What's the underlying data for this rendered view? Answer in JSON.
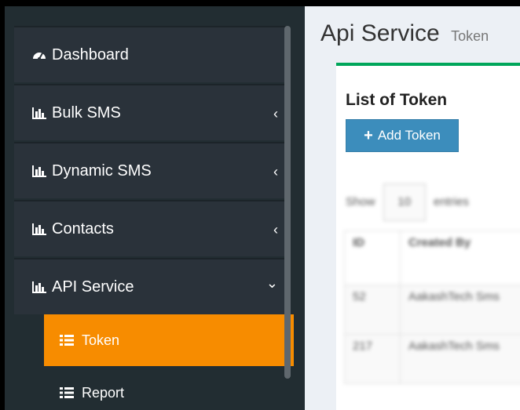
{
  "sidebar": {
    "items": [
      {
        "label": "Dashboard",
        "icon": "dashboard-icon",
        "chevron": ""
      },
      {
        "label": "Bulk SMS",
        "icon": "bar-chart-icon",
        "chevron": "‹"
      },
      {
        "label": "Dynamic SMS",
        "icon": "bar-chart-icon",
        "chevron": "‹"
      },
      {
        "label": "Contacts",
        "icon": "bar-chart-icon",
        "chevron": "‹"
      },
      {
        "label": "API Service",
        "icon": "bar-chart-icon",
        "chevron": "⌄"
      }
    ],
    "subitems": [
      {
        "label": "Token",
        "icon": "list-icon",
        "active": true
      },
      {
        "label": "Report",
        "icon": "list-icon",
        "active": false
      }
    ]
  },
  "header": {
    "title": "Api Service",
    "subtitle": "Token"
  },
  "box": {
    "title": "List of Token",
    "add_button": "Add Token",
    "accent_color": "#00a65a"
  },
  "table_controls": {
    "show_label": "Show",
    "page_size": "10",
    "entries_label": "entries"
  },
  "table": {
    "columns": [
      "ID",
      "Created By"
    ],
    "rows": [
      [
        "52",
        "AakashTech Sms"
      ],
      [
        "217",
        "AakashTech Sms"
      ]
    ]
  },
  "colors": {
    "sidebar_bg": "#222d32",
    "active_item": "#f78c00",
    "button_blue": "#3c8dbc"
  }
}
